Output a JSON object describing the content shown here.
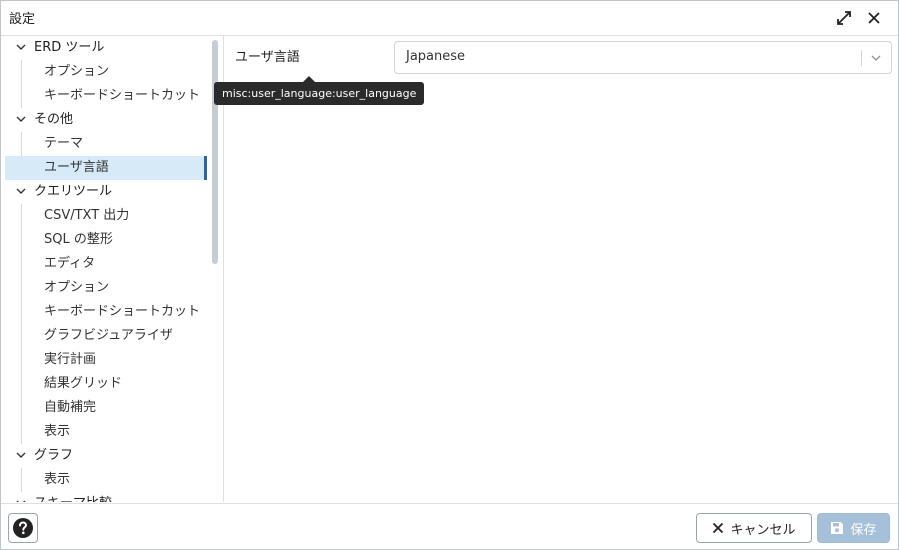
{
  "dialog": {
    "title": "設定",
    "maximize_icon": "expand-arrows-icon",
    "close_icon": "close-x-icon"
  },
  "sidebar": {
    "groups": [
      {
        "label": "ERD ツール",
        "icon": "chevron-down-icon",
        "children": [
          "オプション",
          "キーボードショートカット"
        ]
      },
      {
        "label": "その他",
        "icon": "chevron-down-icon",
        "children": [
          "テーマ",
          "ユーザ言語"
        ]
      },
      {
        "label": "クエリツール",
        "icon": "chevron-down-icon",
        "children": [
          "CSV/TXT 出力",
          "SQL の整形",
          "エディタ",
          "オプション",
          "キーボードショートカット",
          "グラフビジュアライザ",
          "実行計画",
          "結果グリッド",
          "自動補完",
          "表示"
        ]
      },
      {
        "label": "グラフ",
        "icon": "chevron-down-icon",
        "children": [
          "表示"
        ]
      },
      {
        "label": "スキーマ比較",
        "icon": "chevron-down-icon",
        "children": []
      }
    ],
    "selected": "ユーザ言語"
  },
  "content": {
    "field_label": "ユーザ言語",
    "select_value": "Japanese",
    "tooltip": "misc:user_language:user_language"
  },
  "footer": {
    "help_icon": "question-circle-icon",
    "cancel_label": "キャンセル",
    "cancel_icon": "close-x-icon",
    "save_label": "保存",
    "save_icon": "floppy-disk-icon"
  },
  "colors": {
    "selected_bg": "#d6eaf8",
    "selected_bar": "#326690",
    "save_button_bg": "#a6c0da",
    "tooltip_bg": "#2b2b2b"
  }
}
